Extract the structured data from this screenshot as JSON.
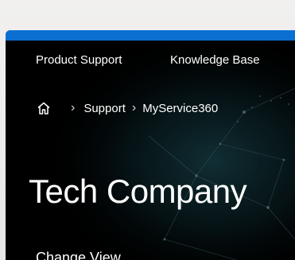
{
  "nav": {
    "items": [
      {
        "label": "Product Support"
      },
      {
        "label": "Knowledge Base"
      }
    ]
  },
  "breadcrumb": {
    "home_icon": "home-icon",
    "separator_icon": "chevron-right-icon",
    "items": [
      {
        "label": "Support"
      },
      {
        "label": "MyService360"
      }
    ]
  },
  "hero": {
    "title": "Tech Company",
    "change_view_label": "Change View"
  },
  "colors": {
    "accent_bar": "#0a6fd1",
    "hero_background": "#000000",
    "text": "#ffffff"
  }
}
